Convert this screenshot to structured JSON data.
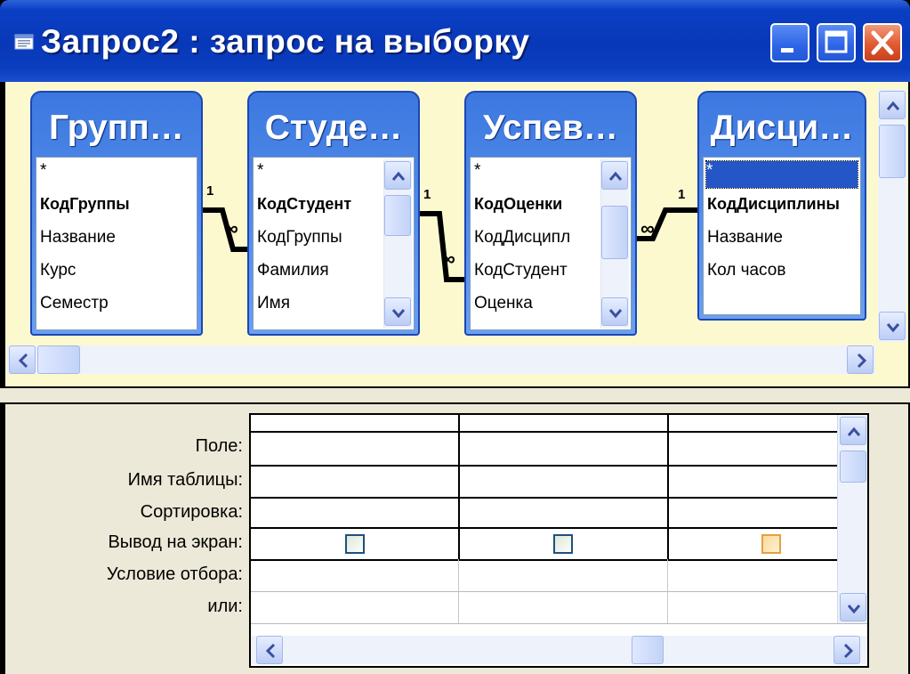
{
  "window": {
    "title": "Запрос2 : запрос на выборку"
  },
  "tables": [
    {
      "title": "Групп…",
      "fields": [
        "*",
        "КодГруппы",
        "Название",
        "Курс",
        "Семестр"
      ],
      "key_field": "КодГруппы"
    },
    {
      "title": "Студе…",
      "fields": [
        "*",
        "КодСтудент",
        "КодГруппы",
        "Фамилия",
        "Имя"
      ],
      "key_field": "КодСтудент"
    },
    {
      "title": "Успев…",
      "fields": [
        "*",
        "КодОценки",
        "КодДисципл",
        "КодСтудент",
        "Оценка"
      ],
      "key_field": "КодОценки"
    },
    {
      "title": "Дисци…",
      "fields": [
        "*",
        "КодДисциплины",
        "Название",
        "Кол часов"
      ],
      "key_field": "КодДисциплины",
      "selected_field": "*"
    }
  ],
  "relationships": [
    {
      "one_label": "1",
      "many_label": "∞"
    },
    {
      "one_label": "1",
      "many_label": "∞"
    },
    {
      "one_label": "1",
      "many_label": "∞"
    }
  ],
  "grid": {
    "row_labels": [
      "Поле:",
      "Имя таблицы:",
      "Сортировка:",
      "Вывод на экран:",
      "Условие отбора:",
      "или:"
    ],
    "show_checkboxes": [
      true,
      true,
      true
    ]
  },
  "colors": {
    "titlebar": "#0838b8",
    "table_header": "#3c78e0",
    "diagram_bg": "#fdf9cf",
    "grid_bg": "#ece9d8",
    "selection": "#2456c8",
    "close_button": "#e05a32"
  },
  "icons": {
    "window": "query-window-icon",
    "minimize": "minimize-icon",
    "maximize": "maximize-icon",
    "close": "close-icon"
  }
}
